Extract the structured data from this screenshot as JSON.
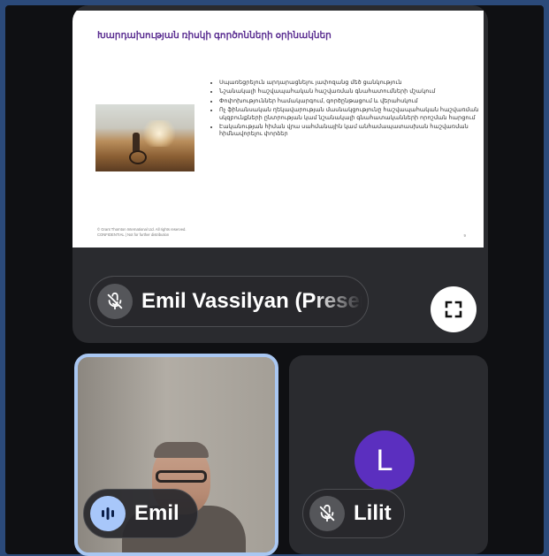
{
  "presentation": {
    "slide_title": "Խարդախության ռիսկի գործոնների օրինակներ",
    "bullets": [
      "Սպառեցրելուն արդարացնելու յափոզանց մեծ ցանկություն",
      "Նշանակալի հաշվապահական հաշվառման գնահատումների մշակում",
      "Փոփոխություններ համակարգում, գործընթացում և վերահսկում",
      "Ոչ ֆինանսական ղեկավարության մասնակցությունը հաշվապահական հաշվառման սկզբունքների ընտրության կամ նշանակալի գնահատականների որոշման հարցում",
      "Էականության հիման վրա սահմանային կամ անհամապատասխան հաշվառման հիմնավորելու փորձեր"
    ],
    "footer_line1": "© Grant Thornton International Ltd. All rights reserved.",
    "footer_line2": "CONFIDENTIAL | Not for further distribution",
    "page_number": "9"
  },
  "presenter": {
    "name": "Emil Vassilyan (Presenting)",
    "muted": true
  },
  "participants": [
    {
      "name": "Emil",
      "speaking": true
    },
    {
      "name": "Lilit",
      "muted": true,
      "avatar_letter": "L"
    }
  ],
  "colors": {
    "slide_title": "#5a2d91",
    "self_border": "#a9c7f2",
    "avatar_bg": "#5b2fbf"
  },
  "icons": {
    "mic_off": "mic-off-icon",
    "fullscreen": "fullscreen-icon",
    "speaking": "audio-level-icon"
  }
}
